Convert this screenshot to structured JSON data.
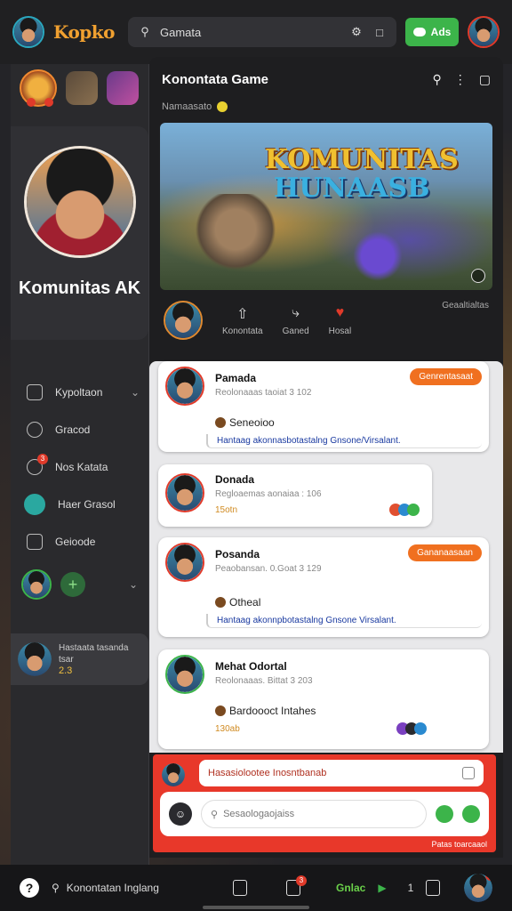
{
  "app": {
    "logo": "Kopko"
  },
  "topbar": {
    "search_placeholder": "Gamata",
    "add_label": "Ads"
  },
  "sidebar": {
    "profile_name": "Komunitas AK",
    "menu": [
      {
        "label": "Kypoltaon",
        "icon": "folder-icon",
        "chevron": true
      },
      {
        "label": "Gracod",
        "icon": "tag-icon"
      },
      {
        "label": "Nos Katata",
        "icon": "chat-icon",
        "badge": "3"
      },
      {
        "label": "Haer Grasol",
        "icon": "search-icon"
      },
      {
        "label": "Geioode",
        "icon": "gallery-icon"
      }
    ],
    "chat_preview": {
      "text": "Hastaata tasanda tsar",
      "meta": "2.3"
    }
  },
  "main": {
    "title": "Konontata Game",
    "subtitle": "Namaasato",
    "banner": {
      "title_line1": "KOMUNITAS",
      "title_line2": "HUNAASB"
    },
    "stats": [
      {
        "label": "Konontata",
        "icon": "upload-icon"
      },
      {
        "label": "Ganed",
        "icon": "share-icon"
      },
      {
        "label": "Hosal",
        "icon": "heart-icon"
      }
    ],
    "stats_right": "Geaaltialtas"
  },
  "posts": [
    {
      "author": "Pamada",
      "meta": "Reolonaaas taoiat 3 102",
      "tag": "Genrentasaat",
      "line2": "Seneoioo",
      "quote": "Hantaag akonnasbotastalng Gnsone/Virsalant."
    },
    {
      "author": "Donada",
      "meta": "Regloaemas aonaiaa : 106",
      "reacts": "15otn"
    },
    {
      "author": "Posanda",
      "meta": "Peaobansan. 0.Goat 3 129",
      "tag": "Gananaasaan",
      "line2": "Otheal",
      "quote": "Hantaag akonnpbotastalng Gnsone Virsalant."
    },
    {
      "author": "Mehat Odortal",
      "meta": "Reolonaaas. Bittat 3 203",
      "line2": "Bardoooct Intahes",
      "reacts": "130ab"
    }
  ],
  "composer": {
    "suggestion": "Hasasiolootee Inosntbanab",
    "placeholder": "Sesaologaojaiss",
    "footer": "Patas toarcaaol"
  },
  "bottombar": {
    "search_label": "Konontatan Inglang",
    "online_label": "Gnlac",
    "count": "1",
    "notif_badge": "3"
  }
}
